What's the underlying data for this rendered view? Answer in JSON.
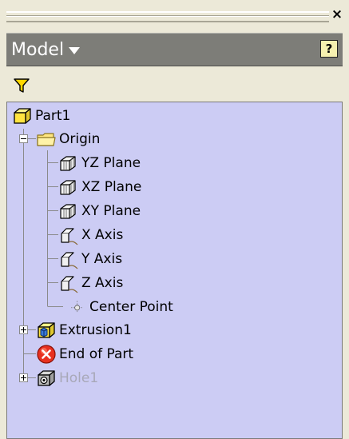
{
  "panel": {
    "close_glyph": "×",
    "header_label": "Model",
    "help_glyph": "?"
  },
  "toolbar": {
    "filter_icon": "filter-funnel-icon",
    "filter_color": "#ffd800"
  },
  "colors": {
    "tree_background": "#ccccf4",
    "header_background": "#7d7d78",
    "panel_background": "#ece9d8",
    "dimmed_text": "#a8a8b8"
  },
  "tree": {
    "root": {
      "label": "Part1",
      "icon": "part-icon"
    },
    "origin": {
      "label": "Origin",
      "icon": "folder-icon",
      "expanded": true,
      "children": [
        {
          "label": "YZ Plane",
          "icon": "work-plane-icon"
        },
        {
          "label": "XZ Plane",
          "icon": "work-plane-icon"
        },
        {
          "label": "XY Plane",
          "icon": "work-plane-icon"
        },
        {
          "label": "X Axis",
          "icon": "work-axis-icon"
        },
        {
          "label": "Y Axis",
          "icon": "work-axis-icon"
        },
        {
          "label": "Z Axis",
          "icon": "work-axis-icon"
        },
        {
          "label": "Center Point",
          "icon": "work-point-icon"
        }
      ]
    },
    "extrusion": {
      "label": "Extrusion1",
      "icon": "extrusion-icon",
      "expanded": false
    },
    "end_of_part": {
      "label": "End of Part",
      "icon": "end-of-part-icon"
    },
    "hole": {
      "label": "Hole1",
      "icon": "hole-icon",
      "expanded": false,
      "dimmed": true
    }
  }
}
